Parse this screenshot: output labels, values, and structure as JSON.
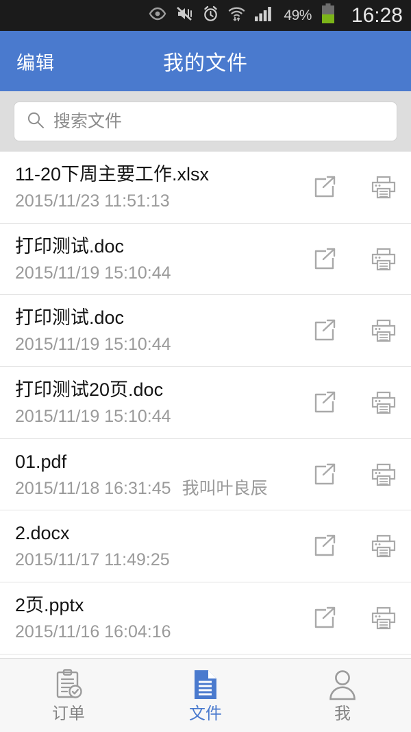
{
  "status_bar": {
    "time": "16:28",
    "battery_percent": "49%",
    "battery_level": 49,
    "icons": [
      "smart-stay-eye-icon",
      "vibrate-mute-icon",
      "alarm-clock-icon",
      "wifi-transfer-icon",
      "cellular-signal-icon",
      "battery-icon"
    ],
    "background_color": "#1b1b1b"
  },
  "header": {
    "edit_label": "编辑",
    "title": "我的文件",
    "background_color": "#4a7ace"
  },
  "search": {
    "placeholder": "搜索文件",
    "value": "",
    "icon": "search-icon"
  },
  "files": [
    {
      "name": "11-20下周主要工作.xlsx",
      "date": "2015/11/23 11:51:13",
      "note": ""
    },
    {
      "name": "打印测试.doc",
      "date": "2015/11/19 15:10:44",
      "note": ""
    },
    {
      "name": "打印测试.doc",
      "date": "2015/11/19 15:10:44",
      "note": ""
    },
    {
      "name": "打印测试20页.doc",
      "date": "2015/11/19 15:10:44",
      "note": ""
    },
    {
      "name": "01.pdf",
      "date": "2015/11/18 16:31:45",
      "note": "我叫叶良辰"
    },
    {
      "name": "2.docx",
      "date": "2015/11/17 11:49:25",
      "note": ""
    },
    {
      "name": "2页.pptx",
      "date": "2015/11/16 16:04:16",
      "note": ""
    }
  ],
  "row_actions": {
    "share_icon": "share-icon",
    "print_icon": "printer-icon"
  },
  "tabbar": {
    "active_index": 1,
    "active_color": "#4a7ace",
    "inactive_color": "#848484",
    "items": [
      {
        "label": "订单",
        "icon": "clipboard-check-icon"
      },
      {
        "label": "文件",
        "icon": "document-icon"
      },
      {
        "label": "我",
        "icon": "person-icon"
      }
    ]
  }
}
